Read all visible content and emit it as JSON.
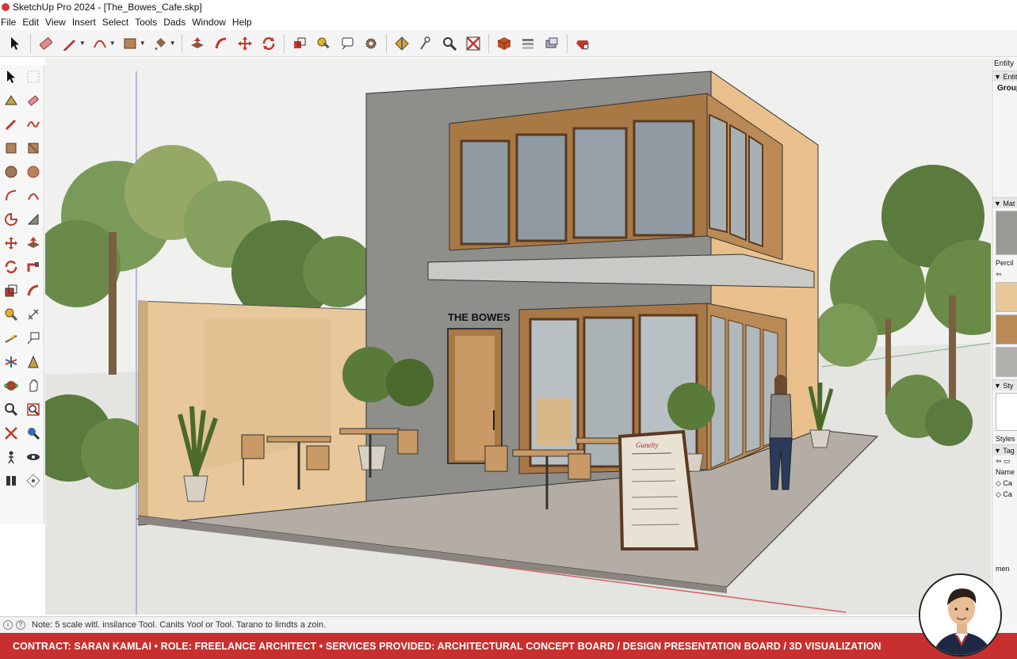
{
  "window": {
    "title": "SketchUp Pro 2024 - [The_Bowes_Cafe.skp]"
  },
  "menu": [
    "File",
    "Edit",
    "View",
    "Insert",
    "Select",
    "Tools",
    "Dads",
    "Window",
    "Help"
  ],
  "toolbar": {
    "tools": [
      "select-arrow-icon",
      "eraser-icon",
      "pencil-line-icon",
      "arc-icon",
      "rectangle-icon",
      "paint-bucket-icon",
      "push-pull-icon",
      "follow-me-icon",
      "move-icon",
      "rotate-icon",
      "component-icon",
      "tape-measure-icon",
      "text-label-icon",
      "settings-gear-icon",
      "section-plane-icon",
      "walk-icon",
      "zoom-icon",
      "zoom-extents-icon",
      "3d-warehouse-icon",
      "layers-icon",
      "extension-warehouse-icon",
      "ruby-icon"
    ]
  },
  "scene": {
    "sign_text": "THE BOWES",
    "menu_board_title": "Gunelty"
  },
  "right_panel": {
    "entity_header": "Entity",
    "entity_section": "Entit",
    "entity_value": "Group",
    "materials_section": "Mat",
    "material_label": "Percil",
    "styles_section": "Sty",
    "styles_label": "Styles",
    "tags_section": "Tag",
    "tags_name_header": "Name",
    "tags": [
      "Ca",
      "Ca"
    ],
    "bottom_label": "men"
  },
  "status": {
    "text": "Note: 5 scale witl. insilance Tool. Canits Yool or Tool. Tarano to limdts a zoin."
  },
  "banner": {
    "text": "CONTRACT: SARAN KAMLAI  • ROLE: FREELANCE ARCHITECT  • SERVICES PROVIDED: ARCHITECTURAL CONCEPT BOARD / DESIGN PRESENTATION BOARD / 3D VISUALIZATION"
  },
  "colors": {
    "banner_red": "#c8302f",
    "wood": "#b98a55",
    "concrete": "#8e8e8b",
    "sky": "#f0f0ee"
  }
}
